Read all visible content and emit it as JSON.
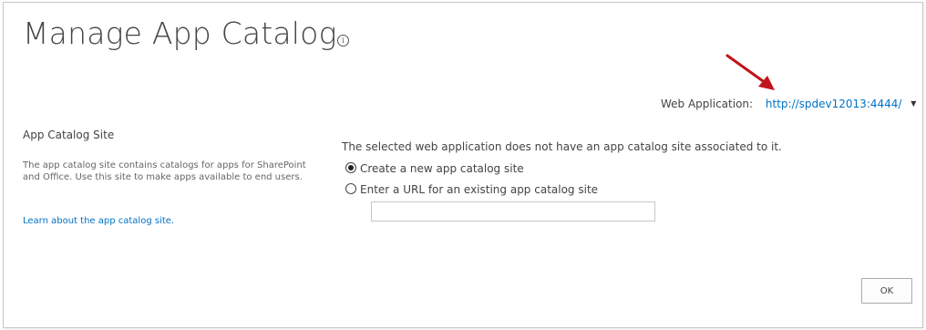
{
  "page": {
    "title": "Manage App Catalog",
    "info_icon": "info-circle-icon"
  },
  "web_application": {
    "label": "Web Application:",
    "value": "http://spdev12013:4444/",
    "caret_icon": "caret-down-icon"
  },
  "annotation": {
    "arrow_icon": "red-arrow-icon",
    "arrow_color": "#c0141c"
  },
  "section": {
    "title": "App Catalog Site",
    "description": "The app catalog site contains catalogs for apps for SharePoint and Office. Use this site to make apps available to end users.",
    "learn_link": "Learn about the app catalog site."
  },
  "main": {
    "notice": "The selected web application does not have an app catalog site associated to it.",
    "options": [
      {
        "label": "Create a new app catalog site",
        "selected": true
      },
      {
        "label": "Enter a URL for an existing app catalog site",
        "selected": false
      }
    ],
    "url_input_value": ""
  },
  "buttons": {
    "ok": "OK"
  },
  "colors": {
    "link": "#0072c6",
    "text": "#444444",
    "border": "#c6c6c6"
  }
}
